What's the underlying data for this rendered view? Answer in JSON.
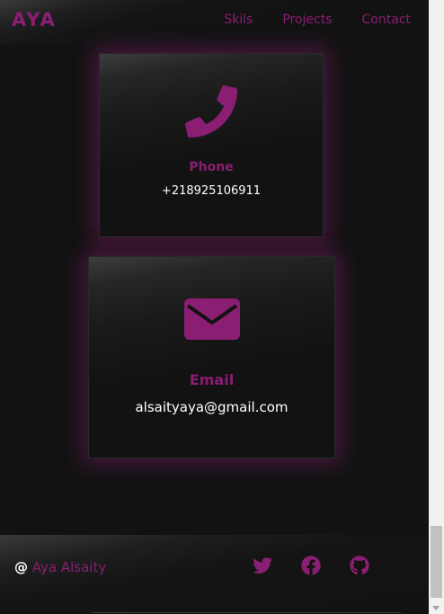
{
  "header": {
    "brand": "AYA",
    "nav": [
      "Skils",
      "Projects",
      "Contact"
    ]
  },
  "contact": {
    "phone": {
      "icon": "phone-icon",
      "title": "Phone",
      "value": "+218925106911"
    },
    "email": {
      "icon": "envelope-icon",
      "title": "Email",
      "value": "alsaityaya@gmail.com"
    }
  },
  "footer": {
    "at": "@",
    "name": "Aya Alsaity",
    "socials": [
      "twitter-icon",
      "facebook-icon",
      "github-icon"
    ]
  },
  "colors": {
    "accent": "#8a1e72",
    "background": "#121212",
    "text": "#ffffff"
  }
}
